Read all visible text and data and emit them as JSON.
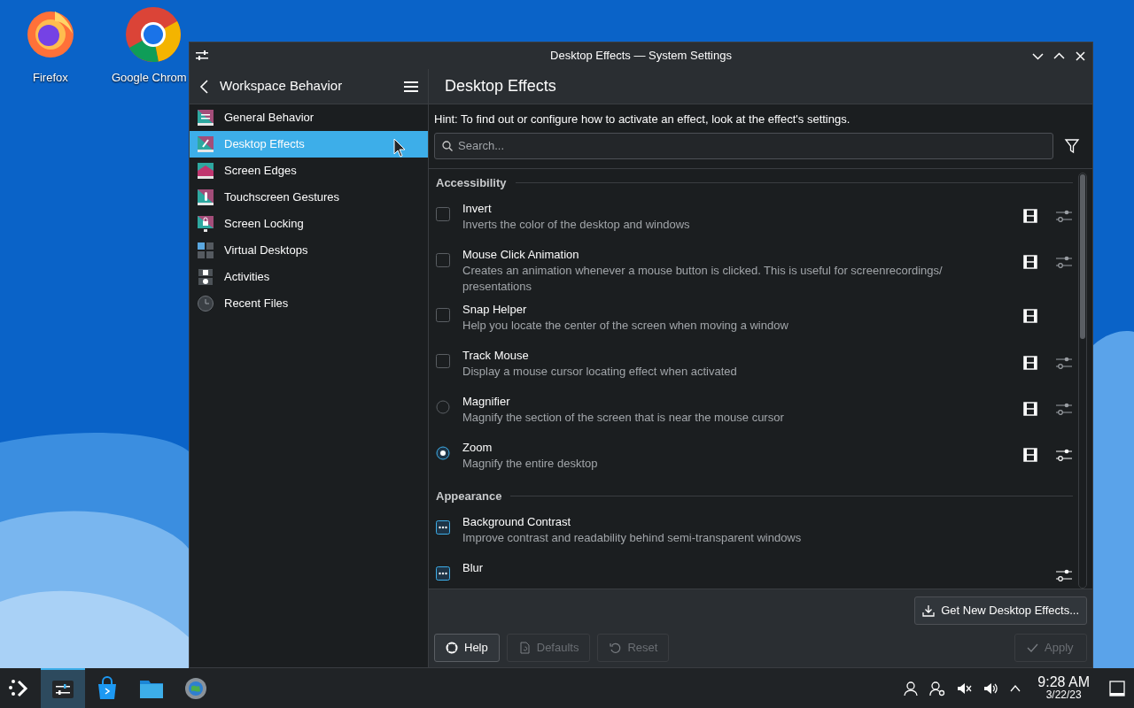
{
  "desktop_icons": [
    {
      "label": "Firefox"
    },
    {
      "label": "Google Chrom"
    }
  ],
  "window": {
    "title": "Desktop Effects — System Settings"
  },
  "sidebar": {
    "header": "Workspace Behavior",
    "items": [
      {
        "label": "General Behavior",
        "selected": false
      },
      {
        "label": "Desktop Effects",
        "selected": true
      },
      {
        "label": "Screen Edges",
        "selected": false
      },
      {
        "label": "Touchscreen Gestures",
        "selected": false
      },
      {
        "label": "Screen Locking",
        "selected": false
      },
      {
        "label": "Virtual Desktops",
        "selected": false
      },
      {
        "label": "Activities",
        "selected": false
      },
      {
        "label": "Recent Files",
        "selected": false
      }
    ]
  },
  "page": {
    "title": "Desktop Effects",
    "hint": "Hint: To find out or configure how to activate an effect, look at the effect's settings.",
    "search": {
      "placeholder": "Search..."
    },
    "sections": [
      {
        "title": "Accessibility",
        "effects": [
          {
            "kind": "checkbox",
            "name": "Invert",
            "description": "Inverts the color of the desktop and windows",
            "checked": false,
            "video": true,
            "configurable": true
          },
          {
            "kind": "checkbox",
            "name": "Mouse Click Animation",
            "description": "Creates an animation whenever a mouse button is clicked. This is useful for screenrecordings/ presentations",
            "checked": false,
            "video": true,
            "configurable": true
          },
          {
            "kind": "checkbox",
            "name": "Snap Helper",
            "description": "Help you locate the center of the screen when moving a window",
            "checked": false,
            "video": true,
            "configurable": false
          },
          {
            "kind": "checkbox",
            "name": "Track Mouse",
            "description": "Display a mouse cursor locating effect when activated",
            "checked": false,
            "video": true,
            "configurable": true
          },
          {
            "kind": "radio",
            "name": "Magnifier",
            "description": "Magnify the section of the screen that is near the mouse cursor",
            "checked": false,
            "video": true,
            "configurable": true
          },
          {
            "kind": "radio",
            "name": "Zoom",
            "description": "Magnify the entire desktop",
            "checked": true,
            "video": true,
            "configurable": true
          }
        ]
      },
      {
        "title": "Appearance",
        "effects": [
          {
            "kind": "default-checkbox",
            "name": "Background Contrast",
            "description": "Improve contrast and readability behind semi-transparent windows",
            "checked": true,
            "video": false,
            "configurable": false
          },
          {
            "kind": "default-checkbox",
            "name": "Blur",
            "checked": true,
            "video": false,
            "configurable": true
          }
        ]
      }
    ],
    "get_new": "Get New Desktop Effects...",
    "buttons": [
      {
        "kind": "help",
        "label": "Help",
        "disabled": false
      },
      {
        "kind": "defaults",
        "label": "Defaults",
        "disabled": true
      },
      {
        "kind": "reset",
        "label": "Reset",
        "disabled": true
      },
      {
        "kind": "apply",
        "label": "Apply",
        "disabled": true
      }
    ]
  },
  "taskbar": {
    "apps": [
      {
        "kind": "settings",
        "selected": true
      },
      {
        "kind": "store",
        "selected": false
      },
      {
        "kind": "files",
        "selected": false
      },
      {
        "kind": "globe",
        "selected": false
      }
    ],
    "time": "9:28 AM",
    "date": "3/22/23"
  }
}
